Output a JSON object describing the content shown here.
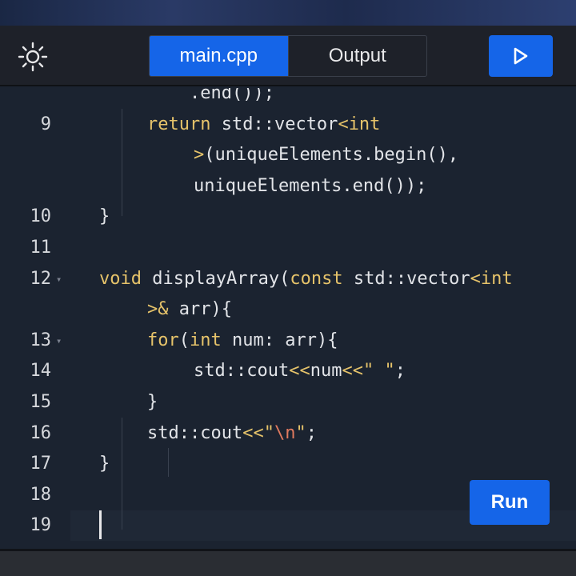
{
  "toolbar": {
    "theme_icon": "sun-icon",
    "tabs": [
      {
        "label": "main.cpp",
        "active": true
      },
      {
        "label": "Output",
        "active": false
      }
    ],
    "play_icon": "play-icon"
  },
  "editor": {
    "lines": [
      {
        "number": "",
        "segments": [
          {
            "t": "    .end());",
            "c": "plain"
          }
        ]
      },
      {
        "number": "9",
        "segments": [
          {
            "t": "return",
            "c": "kw"
          },
          {
            "t": " std::vector",
            "c": "plain"
          },
          {
            "t": "<",
            "c": "op"
          },
          {
            "t": "int",
            "c": "kw"
          }
        ]
      },
      {
        "number": "",
        "segments": [
          {
            "t": ">",
            "c": "op"
          },
          {
            "t": "(uniqueElements.begin(),",
            "c": "plain"
          }
        ]
      },
      {
        "number": "",
        "segments": [
          {
            "t": "uniqueElements.end());",
            "c": "plain"
          }
        ]
      },
      {
        "number": "10",
        "segments": [
          {
            "t": "}",
            "c": "plain"
          }
        ]
      },
      {
        "number": "11",
        "segments": []
      },
      {
        "number": "12",
        "segments": [
          {
            "t": "void",
            "c": "kw"
          },
          {
            "t": " displayArray(",
            "c": "plain"
          },
          {
            "t": "const",
            "c": "kw"
          },
          {
            "t": " std::vector",
            "c": "plain"
          },
          {
            "t": "<",
            "c": "op"
          },
          {
            "t": "int",
            "c": "kw"
          }
        ]
      },
      {
        "number": "",
        "segments": [
          {
            "t": ">&",
            "c": "op"
          },
          {
            "t": " arr){",
            "c": "plain"
          }
        ]
      },
      {
        "number": "13",
        "segments": [
          {
            "t": "for",
            "c": "kw"
          },
          {
            "t": "(",
            "c": "plain"
          },
          {
            "t": "int",
            "c": "kw"
          },
          {
            "t": " num: arr){",
            "c": "plain"
          }
        ]
      },
      {
        "number": "14",
        "segments": [
          {
            "t": "std::cout",
            "c": "plain"
          },
          {
            "t": "<<",
            "c": "op"
          },
          {
            "t": "num",
            "c": "plain"
          },
          {
            "t": "<<",
            "c": "op"
          },
          {
            "t": "\" \"",
            "c": "str"
          },
          {
            "t": ";",
            "c": "plain"
          }
        ]
      },
      {
        "number": "15",
        "segments": [
          {
            "t": "}",
            "c": "plain"
          }
        ]
      },
      {
        "number": "16",
        "segments": [
          {
            "t": "std::cout",
            "c": "plain"
          },
          {
            "t": "<<",
            "c": "op"
          },
          {
            "t": "\"",
            "c": "str"
          },
          {
            "t": "\\n",
            "c": "esc"
          },
          {
            "t": "\"",
            "c": "str"
          },
          {
            "t": ";",
            "c": "plain"
          }
        ]
      },
      {
        "number": "17",
        "segments": [
          {
            "t": "}",
            "c": "plain"
          }
        ]
      },
      {
        "number": "18",
        "segments": []
      },
      {
        "number": "19",
        "segments": []
      }
    ]
  },
  "run_button": {
    "label": "Run"
  },
  "colors": {
    "accent": "#1565e8",
    "editor_bg": "#1b2330",
    "keyword": "#e6c36a"
  }
}
